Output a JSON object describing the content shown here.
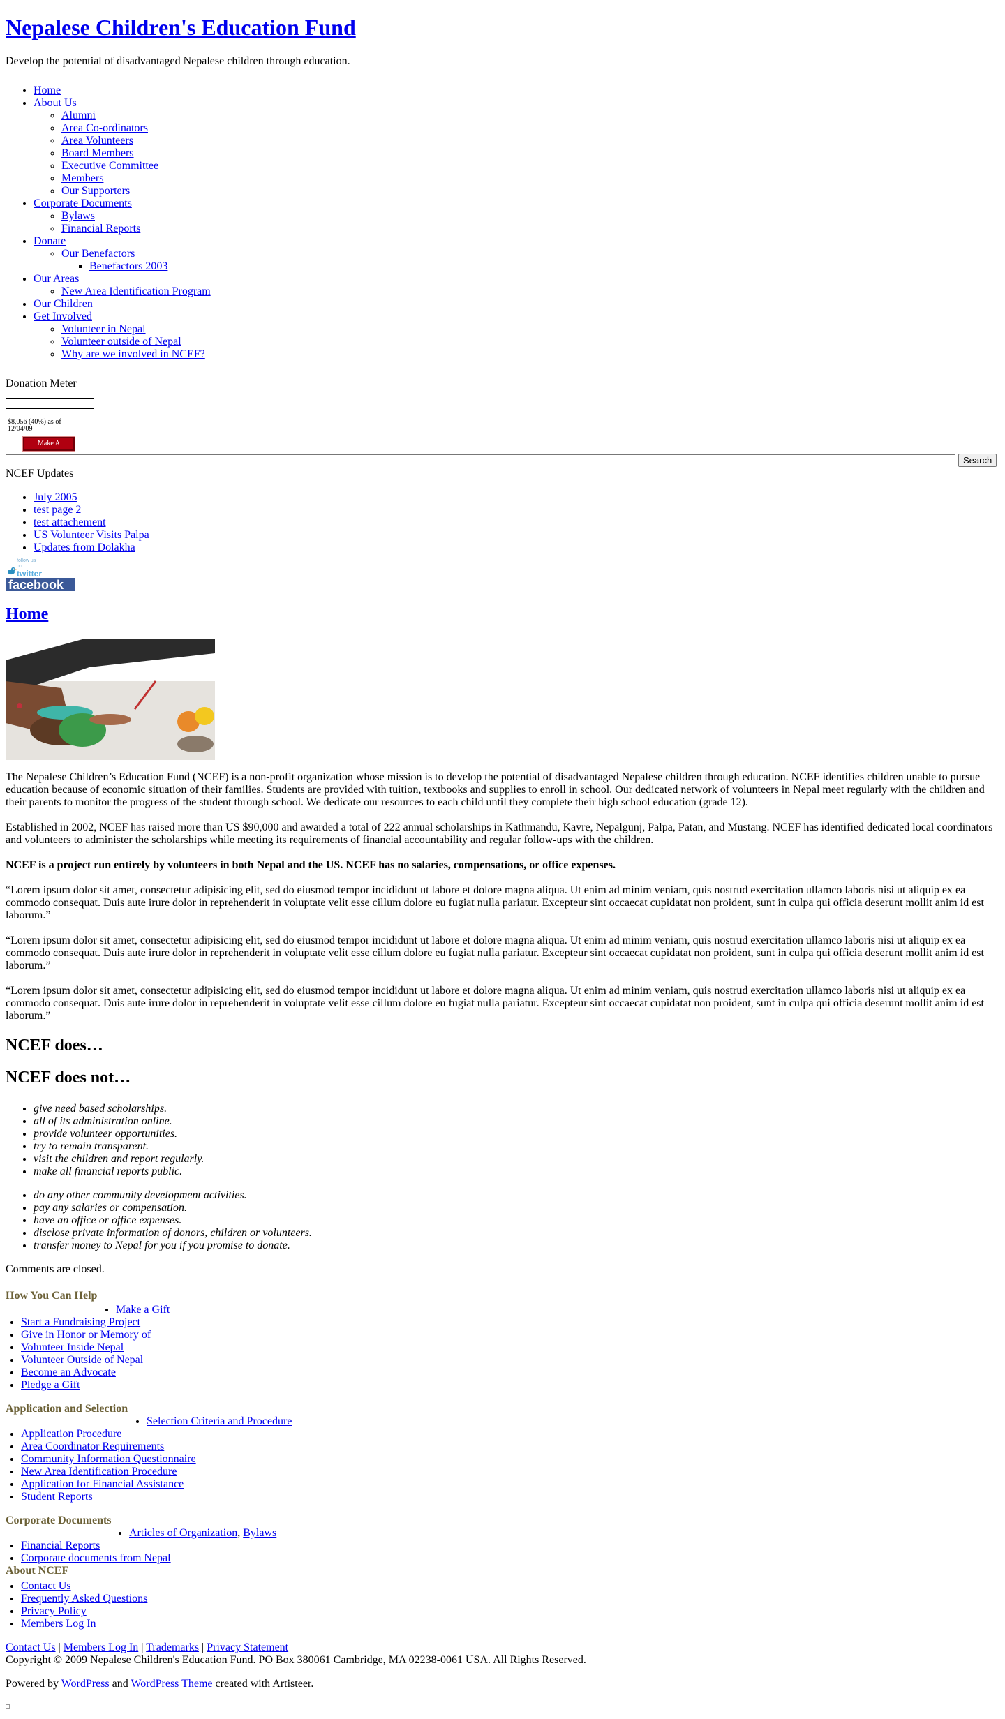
{
  "header": {
    "title": "Nepalese Children's Education Fund",
    "slogan": "Develop the potential of disadvantaged Nepalese children through education."
  },
  "nav": {
    "home": "Home",
    "about": "About Us",
    "about_children": [
      "Alumni",
      "Area Co-ordinators",
      "Area Volunteers",
      "Board Members",
      "Executive Committee",
      "Members",
      "Our Supporters"
    ],
    "corporate": "Corporate Documents",
    "corporate_children": [
      "Bylaws",
      "Financial Reports"
    ],
    "donate": "Donate",
    "benefactors": "Our Benefactors",
    "benefactors_2003": "Benefactors 2003",
    "areas": "Our Areas",
    "new_area": "New Area Identification Program",
    "children": "Our Children",
    "involved": "Get Involved",
    "involved_children": [
      "Volunteer in Nepal",
      "Volunteer outside of Nepal",
      "Why are we involved in NCEF?"
    ]
  },
  "donation": {
    "title": "Donation Meter",
    "progress": 0.4,
    "text_line1": "$8,056 (40%) as of",
    "text_line2": "12/04/09",
    "button": "Make A Donation"
  },
  "search": {
    "button": "Search",
    "value": ""
  },
  "updates": {
    "title": "NCEF Updates",
    "items": [
      "July 2005",
      "test page 2",
      "test attachement",
      "US Volunteer Visits Palpa",
      "Updates from Dolakha"
    ]
  },
  "social": {
    "twitter_small": "follow us on",
    "twitter": "twitter",
    "facebook": "facebook"
  },
  "post": {
    "title": "Home",
    "p1": "The Nepalese Children’s Education Fund (NCEF) is a non-profit organization whose mission is to develop the potential of disadvantaged Nepalese children through education. NCEF identifies children unable to pursue education because of economic situation of their families. Students are provided with tuition, textbooks and supplies to enroll in school. Our dedicated network of volunteers in Nepal meet regularly with the children and their parents to monitor the progress of the student through school. We dedicate our resources to each child until they complete their high school education (grade 12).",
    "p2": "Established in 2002, NCEF has raised more than US $90,000 and awarded a total of 222 annual scholarships in Kathmandu, Kavre, Nepalgunj, Palpa, Patan, and Mustang. NCEF has identified dedicated local coordinators and volunteers to administer the scholarships while meeting its requirements of financial accountability and regular follow-ups with the children.",
    "p3": "NCEF is a project run entirely by volunteers in both Nepal and the US. NCEF has no salaries, compensations, or office expenses.",
    "lorem": "“Lorem ipsum dolor sit amet, consectetur adipisicing elit, sed do eiusmod tempor incididunt ut labore et dolore magna aliqua. Ut enim ad minim veniam, quis nostrud exercitation ullamco laboris nisi ut aliquip ex ea commodo consequat. Duis aute irure dolor in reprehenderit in voluptate velit esse cillum dolore eu fugiat nulla pariatur. Excepteur sint occaecat cupidatat non proident, sunt in culpa qui officia deserunt mollit anim id est laborum.”",
    "does_title": "NCEF does…",
    "does_not_title": "NCEF does not…",
    "does": [
      "give need based scholarships.",
      "all of its administration online.",
      "provide volunteer opportunities.",
      "try to remain transparent.",
      "visit the children and report regularly.",
      "make all financial reports public."
    ],
    "does_not": [
      "do any other community development activities.",
      "pay any salaries or compensation.",
      "have an office or office expenses.",
      "disclose private information of donors, children or volunteers.",
      "transfer money to Nepal for you if you promise to donate."
    ],
    "comments": "Comments are closed."
  },
  "footer_widgets": {
    "help_title": "How You Can Help",
    "help_first": "Make a Gift",
    "help_items": [
      "Start a Fundraising Project",
      "Give in Honor or Memory of",
      "Volunteer Inside Nepal",
      "Volunteer Outside of Nepal",
      "Become an Advocate",
      "Pledge a Gift"
    ],
    "app_title": "Application and Selection",
    "app_first": "Selection Criteria and Procedure",
    "app_items": [
      "Application Procedure",
      "Area Coordinator Requirements",
      "Community Information Questionnaire",
      "New Area Identification Procedure",
      "Application for Financial Assistance",
      "Student Reports"
    ],
    "corp_title": "Corporate Documents",
    "corp_first_a": "Articles of Organization",
    "corp_first_b": "Bylaws",
    "corp_items": [
      "Financial Reports",
      "Corporate documents from Nepal"
    ],
    "about_title": "About NCEF",
    "about_items": [
      "Contact Us",
      "Frequently Asked Questions",
      "Privacy Policy",
      "Members Log In"
    ]
  },
  "footer": {
    "links": [
      "Contact Us",
      "Members Log In",
      "Trademarks",
      "Privacy Statement"
    ],
    "copyright": "Copyright © 2009 Nepalese Children's Education Fund. PO Box 380061 Cambridge, MA 02238-0061 USA. All Rights Reserved.",
    "powered_prefix": "Powered by",
    "wordpress": "WordPress",
    "and": "and",
    "wp_theme": "WordPress Theme",
    "created": "created with Artisteer."
  }
}
